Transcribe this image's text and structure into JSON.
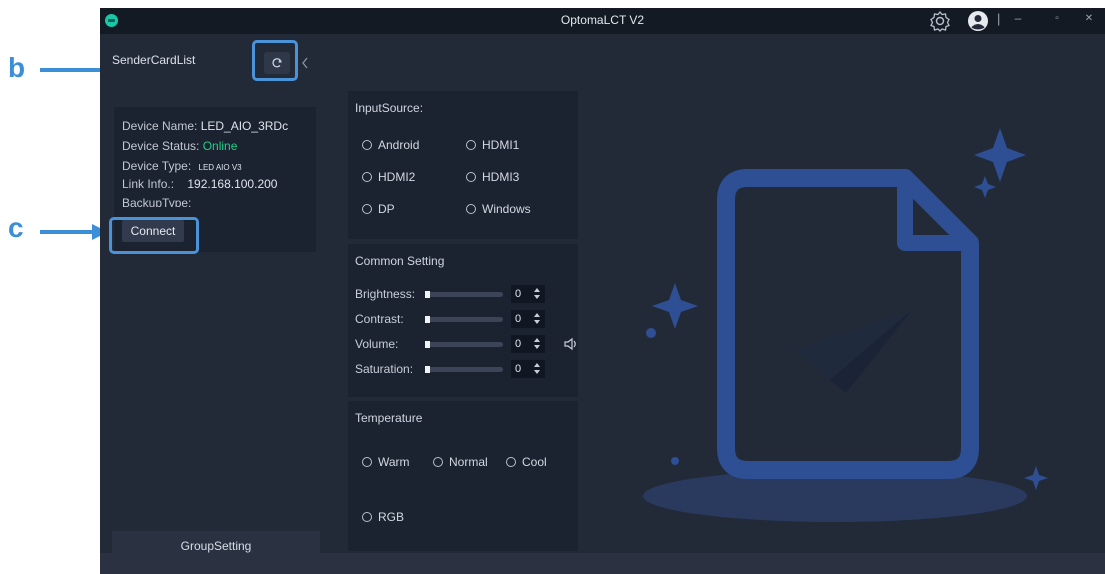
{
  "window": {
    "title": "OptomaLCT V2"
  },
  "sidebar": {
    "title": "SenderCardList",
    "refresh_icon": "refresh-icon",
    "collapse_icon": "chevron-left-icon",
    "group_tab": "GroupSetting"
  },
  "device": {
    "name_label": "Device Name:",
    "name_value": "LED_AIO_3RDc",
    "status_label": "Device Status:",
    "status_value": "Online",
    "type_label": "Device Type:",
    "type_value": "LED AIO V3",
    "link_label": "Link Info.:",
    "link_value": "192.168.100.200",
    "backup_label": "BackupType:",
    "connect_label": "Connect"
  },
  "input_source": {
    "title": "InputSource:",
    "options": [
      "Android",
      "HDMI1",
      "HDMI2",
      "HDMI3",
      "DP",
      "Windows"
    ]
  },
  "common": {
    "title": "Common Setting",
    "brightness_label": "Brightness:",
    "brightness_value": "0",
    "contrast_label": "Contrast:",
    "contrast_value": "0",
    "volume_label": "Volume:",
    "volume_value": "0",
    "saturation_label": "Saturation:",
    "saturation_value": "0"
  },
  "temperature": {
    "title": "Temperature",
    "options": [
      "Warm",
      "Normal",
      "Cool",
      "RGB"
    ]
  },
  "annotations": {
    "b": "b",
    "c": "c"
  },
  "colors": {
    "accent": "#4a93d9",
    "online": "#1fd18a",
    "illustration": "#2e4f93"
  }
}
